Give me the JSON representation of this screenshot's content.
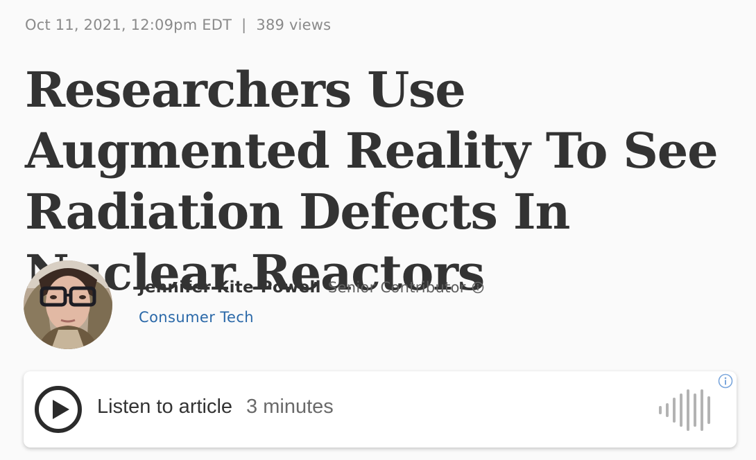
{
  "meta": {
    "date": "Oct 11, 2021, 12:09pm EDT",
    "separator": "|",
    "views": "389 views"
  },
  "headline": "Researchers Use Augmented Reality To See Radiation Defects In Nuclear Reactors",
  "author": {
    "name": "Jennifer Kite-Powell",
    "role": "Senior Contributor",
    "channel": "Consumer Tech",
    "info_icon": "info-icon"
  },
  "player": {
    "label": "Listen to article",
    "duration": "3 minutes",
    "play_icon": "play-icon",
    "waveform_icon": "audio-waveform-icon",
    "info_icon": "info-icon"
  },
  "colors": {
    "text": "#333333",
    "meta": "#8a8a8a",
    "link": "#2a68a8",
    "info_blue": "#7aa6dc",
    "background": "#fafafa"
  }
}
